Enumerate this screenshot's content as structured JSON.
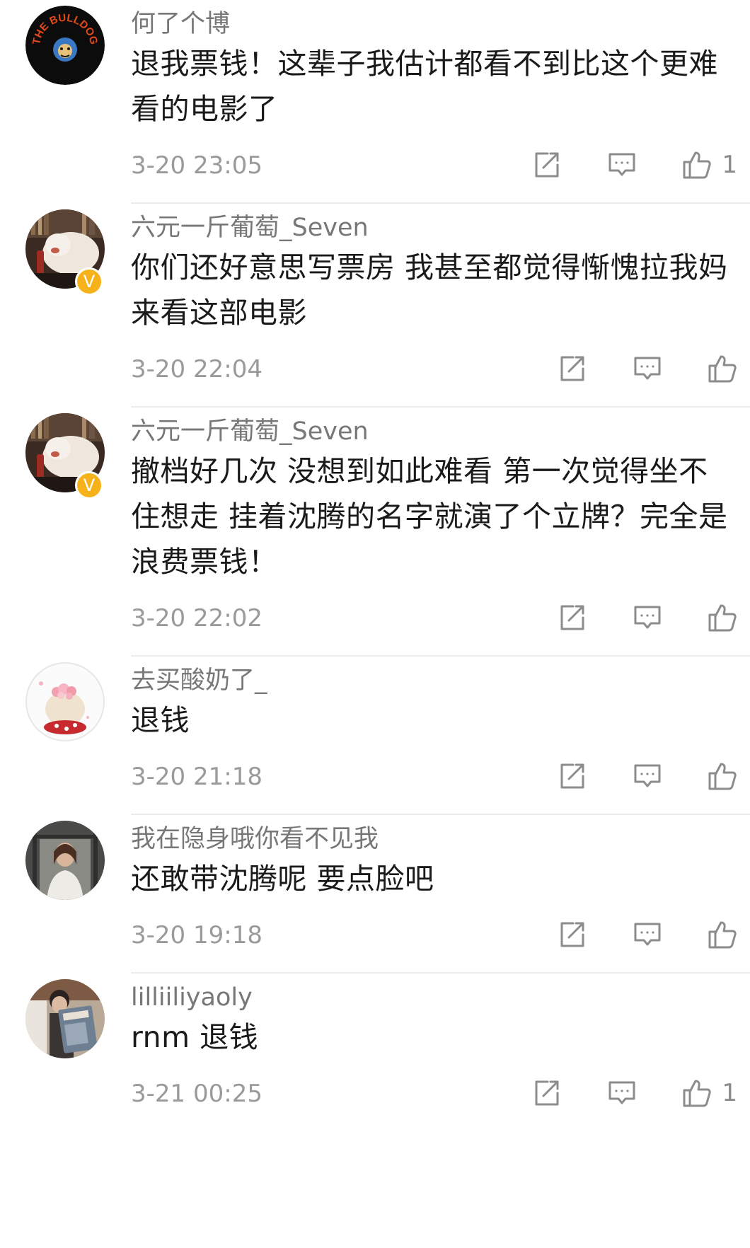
{
  "comments": [
    {
      "username": "何了个博",
      "text": "退我票钱！这辈子我估计都看不到比这个更难看的电影了",
      "time": "3-20 23:05",
      "likes": "1",
      "verified": false,
      "avatar": "bulldog-logo",
      "avatar_text": "THE BULLDOG"
    },
    {
      "username": "六元一斤葡萄_Seven",
      "text": "你们还好意思写票房 我甚至都觉得惭愧拉我妈来看这部电影",
      "time": "3-20 22:04",
      "likes": "",
      "verified": true,
      "avatar": "dog-photo"
    },
    {
      "username": "六元一斤葡萄_Seven",
      "text": "撤档好几次 没想到如此难看 第一次觉得坐不住想走 挂着沈腾的名字就演了个立牌？完全是浪费票钱！",
      "time": "3-20 22:02",
      "likes": "",
      "verified": true,
      "avatar": "dog-photo"
    },
    {
      "username": "去买酸奶了_",
      "text": "退钱",
      "time": "3-20 21:18",
      "likes": "",
      "verified": false,
      "avatar": "flower-cake"
    },
    {
      "username": "我在隐身哦你看不见我",
      "text": "还敢带沈腾呢  要点脸吧",
      "time": "3-20 19:18",
      "likes": "",
      "verified": false,
      "avatar": "woman-window"
    },
    {
      "username": "lilliiliyaoly",
      "text": "rnm  退钱",
      "time": "3-21 00:25",
      "likes": "1",
      "verified": false,
      "avatar": "book-photo"
    }
  ],
  "icons": {
    "repost": "repost-icon",
    "reply": "comment-icon",
    "like": "thumbs-up-icon",
    "verified": "verified-v-icon"
  },
  "verified_badge_label": "V",
  "colors": {
    "username": "#777777",
    "text": "#1a1a1a",
    "timestamp": "#9a9a9a",
    "icon": "#8c8c8c",
    "divider": "#ececec",
    "verified_badge": "#f6b21a"
  }
}
